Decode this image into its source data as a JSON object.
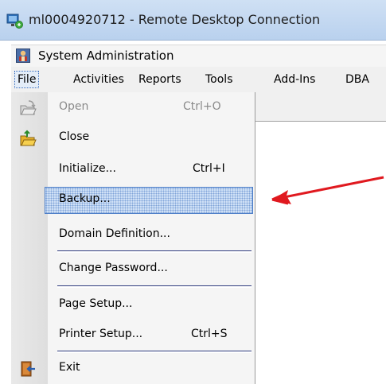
{
  "rdp_window": {
    "title": "ml0004920712 - Remote Desktop Connection",
    "icon": "remote-desktop-icon"
  },
  "app_window": {
    "title": "System Administration",
    "icon": "system-admin-icon"
  },
  "menubar": {
    "items": [
      "File",
      "Activities",
      "Reports",
      "Tools",
      "Add-Ins",
      "DBA"
    ],
    "active": "File"
  },
  "file_menu": {
    "items": [
      {
        "label": "Open",
        "shortcut": "Ctrl+O",
        "disabled": true,
        "icon": "open-folder-icon"
      },
      {
        "label": "Close",
        "shortcut": "",
        "disabled": false,
        "icon": "close-folder-icon"
      },
      {
        "label": "Initialize...",
        "shortcut": "Ctrl+I",
        "disabled": false,
        "icon": ""
      },
      {
        "label": "Backup...",
        "shortcut": "",
        "disabled": false,
        "selected": true,
        "icon": ""
      },
      {
        "label": "Domain Definition...",
        "shortcut": "",
        "disabled": false,
        "icon": ""
      },
      {
        "label": "Change Password...",
        "shortcut": "",
        "disabled": false,
        "icon": ""
      },
      {
        "label": "Page Setup...",
        "shortcut": "",
        "disabled": false,
        "icon": ""
      },
      {
        "label": "Printer Setup...",
        "shortcut": "Ctrl+S",
        "disabled": false,
        "icon": ""
      },
      {
        "label": "Exit",
        "shortcut": "",
        "disabled": false,
        "icon": "exit-door-icon"
      }
    ]
  },
  "annotation": {
    "type": "red-arrow-pointing-left",
    "color": "#e0191f"
  },
  "colors": {
    "highlight_border": "#4a7cc7",
    "separator": "#2f3c7e",
    "arrow": "#e0191f"
  }
}
